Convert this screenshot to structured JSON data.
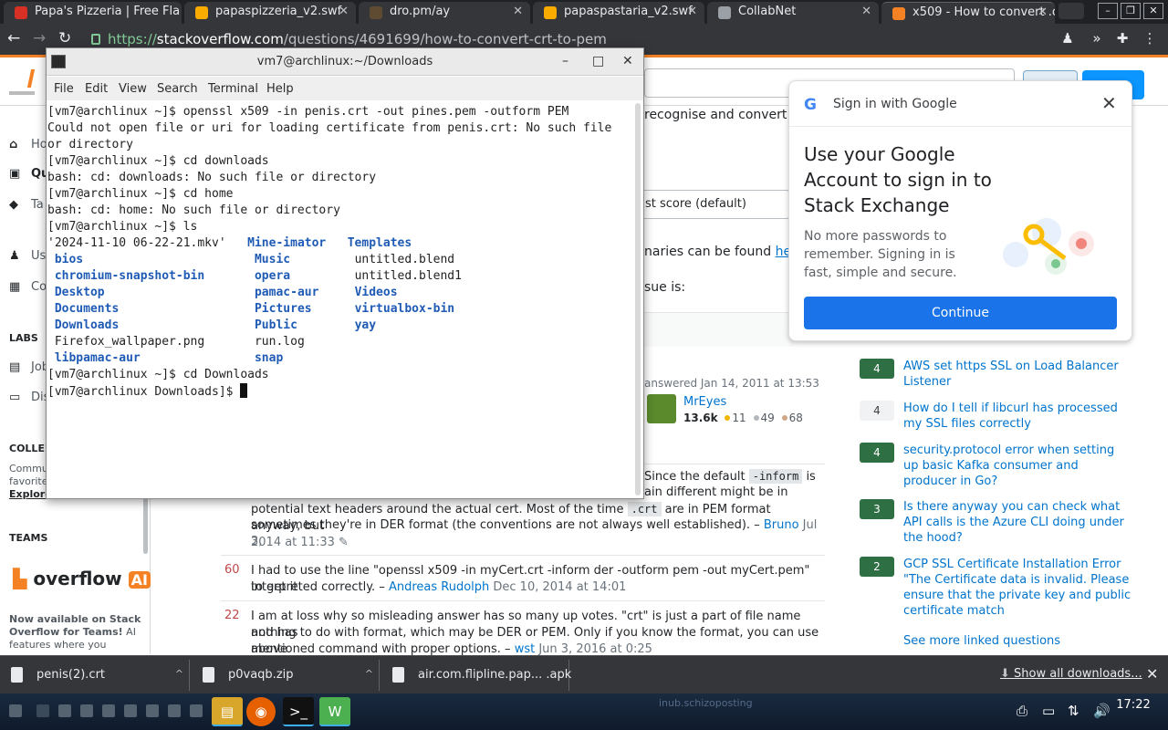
{
  "browser": {
    "tabs": [
      {
        "title": "Papa's Pizzeria | Free Fla",
        "color": "#d93025"
      },
      {
        "title": "papaspizzeria_v2.swf",
        "color": "#f9ab00"
      },
      {
        "title": "dro.pm/ay",
        "color": "#5f4b32"
      },
      {
        "title": "papaspastaria_v2.swf",
        "color": "#f9ab00"
      },
      {
        "title": "CollabNet",
        "color": "#9aa0a6"
      },
      {
        "title": "x509 - How to convert .c",
        "color": "#f48225"
      }
    ],
    "url_scheme": "https://",
    "url_host": "stackoverflow.com",
    "url_path": "/questions/4691699/how-to-convert-crt-to-pem"
  },
  "terminal": {
    "title": "vm7@archlinux:~/Downloads",
    "menu": [
      "File",
      "Edit",
      "View",
      "Search",
      "Terminal",
      "Help"
    ],
    "lines": [
      "[vm7@archlinux ~]$ openssl x509 -in penis.crt -out pines.pem -outform PEM",
      "Could not open file or uri for loading certificate from penis.crt: No such file",
      "or directory",
      "[vm7@archlinux ~]$ cd downloads",
      "bash: cd: downloads: No such file or directory",
      "[vm7@archlinux ~]$ cd home",
      "bash: cd: home: No such file or directory",
      "[vm7@archlinux ~]$ ls"
    ],
    "ls_columns": [
      [
        {
          "name": "'2024-11-10 06-22-21.mkv'",
          "dir": false
        },
        {
          "name": "bios",
          "dir": true
        },
        {
          "name": "chromium-snapshot-bin",
          "dir": true
        },
        {
          "name": "Desktop",
          "dir": true
        },
        {
          "name": "Documents",
          "dir": true
        },
        {
          "name": "Downloads",
          "dir": true
        },
        {
          "name": "Firefox_wallpaper.png",
          "dir": false
        },
        {
          "name": "libpamac-aur",
          "dir": true
        }
      ],
      [
        {
          "name": "Mine-imator",
          "dir": true
        },
        {
          "name": "Music",
          "dir": true
        },
        {
          "name": "opera",
          "dir": true
        },
        {
          "name": "pamac-aur",
          "dir": true
        },
        {
          "name": "Pictures",
          "dir": true
        },
        {
          "name": "Public",
          "dir": true
        },
        {
          "name": "run.log",
          "dir": false
        },
        {
          "name": "snap",
          "dir": true
        }
      ],
      [
        {
          "name": "Templates",
          "dir": true
        },
        {
          "name": "untitled.blend",
          "dir": false
        },
        {
          "name": "untitled.blend1",
          "dir": false
        },
        {
          "name": "Videos",
          "dir": true
        },
        {
          "name": "virtualbox-bin",
          "dir": true
        },
        {
          "name": "yay",
          "dir": true
        }
      ]
    ],
    "after_lines": [
      "[vm7@archlinux ~]$ cd Downloads",
      "[vm7@archlinux Downloads]$ "
    ]
  },
  "so": {
    "nav": {
      "home": "Hor",
      "questions": "Qu",
      "tags": "Ta",
      "users": "Us",
      "companies": "Co",
      "labs": "LABS",
      "jobs": "Job",
      "discussions": "Dis",
      "collectives_head": "COLLE",
      "collectives_text_1": "Commu",
      "collectives_text_2": "favorite",
      "explore": "Explore",
      "teams": "TEAMS",
      "overflow_ai_word": "overflow",
      "overflow_ai_badge": "AI",
      "teams_pitch_1": "Now available on Stack",
      "teams_pitch_2": "Overflow for Teams!",
      "teams_pitch_2b": " AI",
      "teams_pitch_3": "features where you"
    },
    "q_snippet_1": "recognise and convert the",
    "sort_label": "st score (default)",
    "q_snippet_2": "naries can be found ",
    "q_snippet_2_link": "he",
    "q_snippet_3": "sue is:",
    "answered": "answered Jan 14, 2011 at 13:53",
    "user": {
      "name": "MrEyes",
      "rep": "13.6k",
      "gold": "11",
      "silver": "49",
      "bronze": "68"
    },
    "comments": [
      {
        "score": "",
        "pre": "Since the default ",
        "code": "-inform",
        "post": " is",
        "line2": "ain different might be in",
        "line3a": "potential text headers around the actual cert. Most of the time ",
        "code2": ".crt",
        "line3b": " are in PEM format anyway, but",
        "line4": "sometimes they're in DER format (the conventions are not always well established). – ",
        "who": "Bruno",
        "when": " Jul 3,",
        "when2": "2014 at 11:33"
      },
      {
        "score": "60",
        "text": "I had to use the line \"openssl x509 -in myCert.crt -inform der -outform pem -out myCert.pem\" to get it",
        "text2": "interpreted correctly. – ",
        "who": "Andreas Rudolph",
        "when": " Dec 10, 2014 at 14:01"
      },
      {
        "score": "22",
        "text": "I am at loss why so misleading answer has so many up votes. \"crt\" is just a part of file name and has",
        "text2": "nothing to do with format, which may be DER or PEM. Only if you know the format, you can use above",
        "text3": "mentioned command with proper options. – ",
        "who": "wst",
        "when": " Jun 3, 2016 at 0:25"
      }
    ],
    "linked": [
      {
        "score": "4",
        "accepted": true,
        "title": "AWS set https SSL on Load Balancer Listener"
      },
      {
        "score": "4",
        "accepted": false,
        "title": "How do I tell if libcurl has processed my SSL files correctly"
      },
      {
        "score": "4",
        "accepted": true,
        "title": "security.protocol error when setting up basic Kafka consumer and producer in Go?"
      },
      {
        "score": "3",
        "accepted": true,
        "title": "Is there anyway you can check what API calls is the Azure CLI doing under the hood?"
      },
      {
        "score": "2",
        "accepted": true,
        "title": "GCP SSL Certificate Installation Error \"The Certificate data is invalid. Please ensure that the private key and public certificate match"
      }
    ],
    "see_more": "See more linked questions"
  },
  "google": {
    "header": "Sign in with Google",
    "title": "Use your Google Account to sign in to Stack Exchange",
    "desc": "No more passwords to remember. Signing in is fast, simple and secure.",
    "button": "Continue"
  },
  "downloads": {
    "items": [
      "penis(2).crt",
      "p0vaqb.zip",
      "air.com.flipline.pap... .apk"
    ],
    "show_all": "Show all downloads..."
  },
  "taskbar": {
    "time": "17:22",
    "ghost_text": "inub.schizoposting"
  },
  "colors": {
    "so_orange": "#f48225",
    "so_link": "#0074cc",
    "accepted_green": "#2f6f44",
    "google_blue": "#1a73e8",
    "terminal_dir": "#1f5bb5"
  }
}
